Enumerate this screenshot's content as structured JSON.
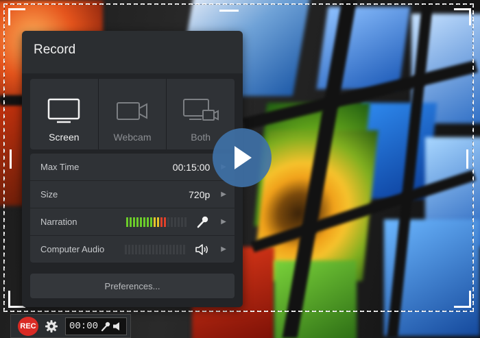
{
  "panel": {
    "title": "Record"
  },
  "modes": [
    {
      "label": "Screen",
      "icon": "monitor-icon",
      "active": true
    },
    {
      "label": "Webcam",
      "icon": "webcam-icon",
      "active": false
    },
    {
      "label": "Both",
      "icon": "screen-and-webcam-icon",
      "active": false
    }
  ],
  "settings": {
    "max_time": {
      "label": "Max Time",
      "value": "00:15:00"
    },
    "size": {
      "label": "Size",
      "value": "720p"
    },
    "narration": {
      "label": "Narration",
      "level": 0.67,
      "icon": "microphone-icon"
    },
    "computer_audio": {
      "label": "Computer Audio",
      "level": 0.0,
      "icon": "speaker-icon"
    }
  },
  "preferences_label": "Preferences...",
  "toolbar": {
    "rec_label": "REC",
    "time": "00:00"
  },
  "colors": {
    "accent_blue": "#3f72aa",
    "rec_red": "#d92b25",
    "meter_green": "#6ccc2a",
    "meter_yellow": "#e7c52a",
    "meter_red": "#e0412a",
    "meter_off": "#3c3f43"
  }
}
